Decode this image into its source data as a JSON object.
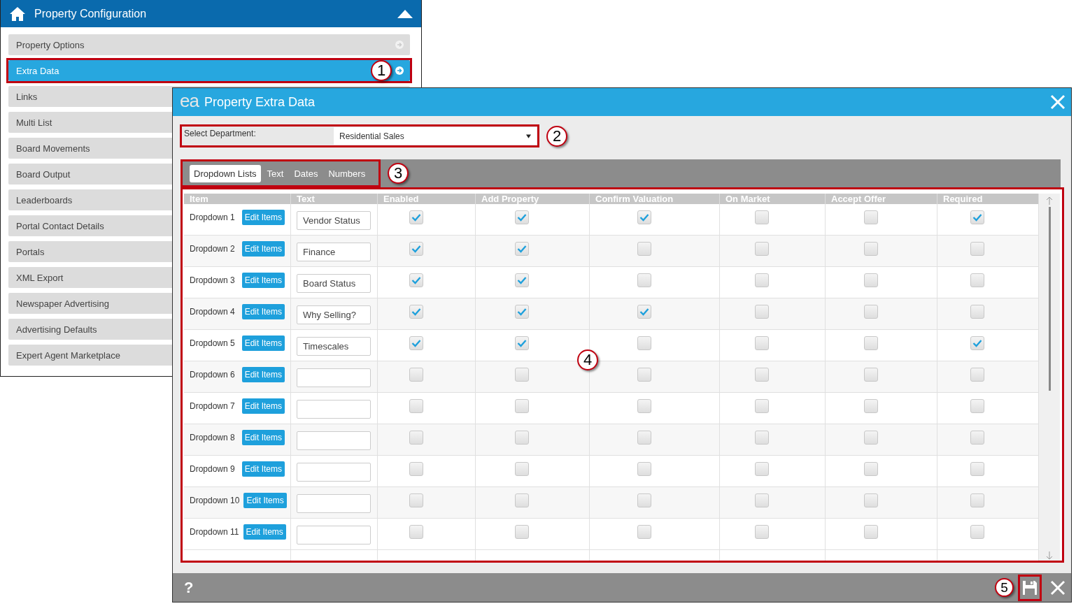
{
  "panel": {
    "title": "Property Configuration",
    "items": [
      {
        "label": "Property Options",
        "selected": false,
        "highlighted": false
      },
      {
        "label": "Extra Data",
        "selected": true,
        "callout": "1",
        "highlighted": true
      },
      {
        "label": "Links",
        "selected": false,
        "highlighted": false
      },
      {
        "label": "Multi List",
        "selected": false,
        "highlighted": false
      },
      {
        "label": "Board Movements",
        "selected": false,
        "highlighted": false
      },
      {
        "label": "Board Output",
        "selected": false,
        "highlighted": false
      },
      {
        "label": "Leaderboards",
        "selected": false,
        "highlighted": false
      },
      {
        "label": "Portal Contact Details",
        "selected": false,
        "highlighted": false
      },
      {
        "label": "Portals",
        "selected": false,
        "highlighted": false
      },
      {
        "label": "XML Export",
        "selected": false,
        "highlighted": false
      },
      {
        "label": "Newspaper Advertising",
        "selected": false,
        "highlighted": false
      },
      {
        "label": "Advertising Defaults",
        "selected": false,
        "highlighted": false
      },
      {
        "label": "Expert Agent Marketplace",
        "selected": false,
        "highlighted": false
      }
    ]
  },
  "dialog": {
    "logo": "ea",
    "title": "Property Extra Data",
    "department": {
      "label": "Select Department:",
      "value": "Residential Sales",
      "callout": "2"
    },
    "tabs": [
      {
        "label": "Dropdown Lists",
        "selected": true
      },
      {
        "label": "Text",
        "selected": false
      },
      {
        "label": "Dates",
        "selected": false
      },
      {
        "label": "Numbers",
        "selected": false
      }
    ],
    "tabs_callout": "3",
    "table": {
      "callout": "4",
      "columns": [
        "Item",
        "Text",
        "Enabled",
        "Add Property",
        "Confirm Valuation",
        "On Market",
        "Accept Offer",
        "Required"
      ],
      "rows": [
        {
          "item": "Dropdown 1",
          "button": "Edit Items",
          "text": "Vendor Status",
          "checks": [
            true,
            true,
            true,
            false,
            false,
            true
          ]
        },
        {
          "item": "Dropdown 2",
          "button": "Edit Items",
          "text": "Finance",
          "checks": [
            true,
            true,
            false,
            false,
            false,
            false
          ]
        },
        {
          "item": "Dropdown 3",
          "button": "Edit Items",
          "text": "Board Status",
          "checks": [
            true,
            true,
            false,
            false,
            false,
            false
          ]
        },
        {
          "item": "Dropdown 4",
          "button": "Edit Items",
          "text": "Why Selling?",
          "checks": [
            true,
            true,
            true,
            false,
            false,
            false
          ]
        },
        {
          "item": "Dropdown 5",
          "button": "Edit Items",
          "text": "Timescales",
          "checks": [
            true,
            true,
            false,
            false,
            false,
            true
          ]
        },
        {
          "item": "Dropdown 6",
          "button": "Edit Items",
          "checks": [
            false,
            false,
            false,
            false,
            false,
            false
          ]
        },
        {
          "item": "Dropdown 7",
          "button": "Edit Items",
          "checks": [
            false,
            false,
            false,
            false,
            false,
            false
          ]
        },
        {
          "item": "Dropdown 8",
          "button": "Edit Items",
          "checks": [
            false,
            false,
            false,
            false,
            false,
            false
          ]
        },
        {
          "item": "Dropdown 9",
          "button": "Edit Items",
          "checks": [
            false,
            false,
            false,
            false,
            false,
            false
          ]
        },
        {
          "item": "Dropdown 10",
          "button": "Edit Items",
          "checks": [
            false,
            false,
            false,
            false,
            false,
            false
          ]
        },
        {
          "item": "Dropdown 11",
          "button": "Edit Items",
          "checks": [
            false,
            false,
            false,
            false,
            false,
            false
          ]
        }
      ]
    },
    "footer": {
      "help": "?",
      "save_callout": "5"
    }
  }
}
